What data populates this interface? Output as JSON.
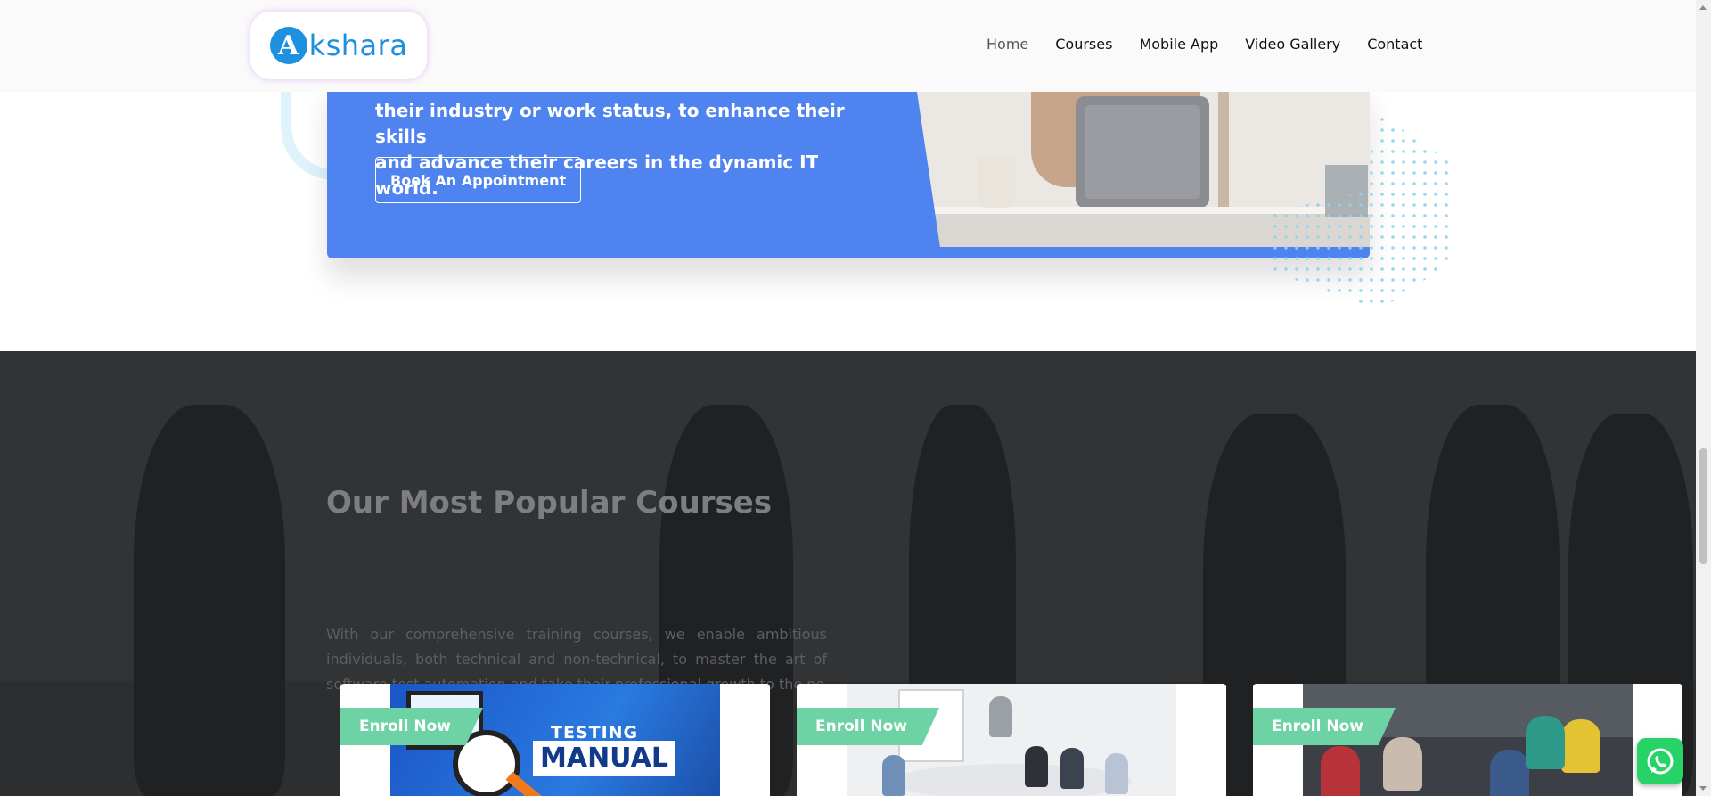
{
  "brand": {
    "logo_letter": "A",
    "logo_text": "kshara"
  },
  "nav": {
    "items": [
      "Home",
      "Courses",
      "Mobile App",
      "Video Gallery",
      "Contact"
    ],
    "active": "Home"
  },
  "hero": {
    "text_line_1": "their industry or work status, to enhance their skills",
    "text_line_2": "and advance their careers in the dynamic IT world.",
    "cta_label": "Book An Appointment"
  },
  "courses": {
    "title": "Our Most Popular Courses",
    "description": "With our comprehensive training courses, we enable ambitious individuals, both technical and non-technical, to master the art of software test automation and take their professional growth to the ne",
    "cards": [
      {
        "enroll_label": "Enroll Now",
        "image_text_top": "TESTING",
        "image_text_main": "MANUAL"
      },
      {
        "enroll_label": "Enroll Now"
      },
      {
        "enroll_label": "Enroll Now"
      }
    ]
  },
  "colors": {
    "brand_blue": "#1e90e0",
    "hero_blue": "#4f83f0",
    "enroll_green": "#6dd2a4",
    "whatsapp_green": "#25d366",
    "section_dark": "#2d2e30"
  }
}
